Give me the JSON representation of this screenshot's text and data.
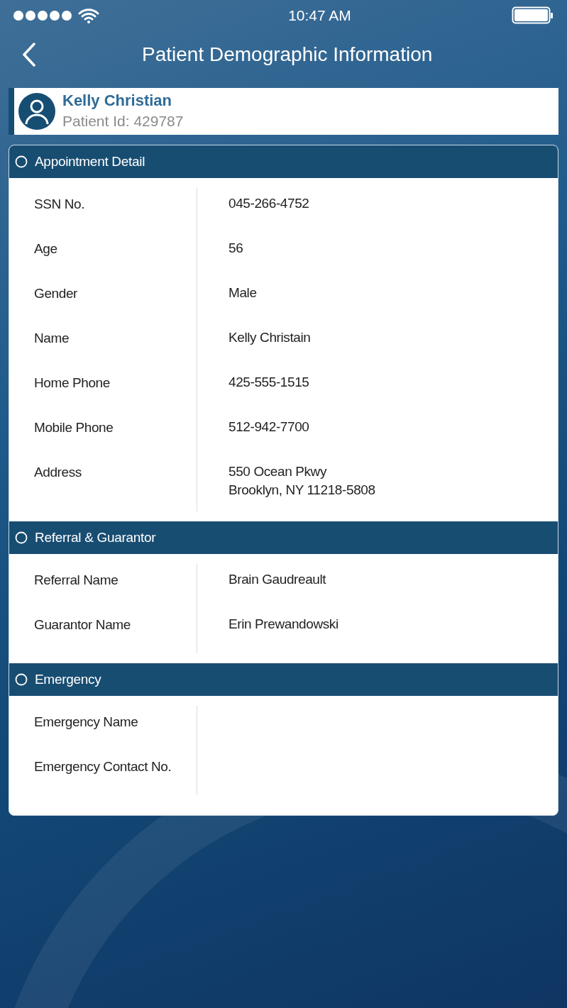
{
  "status_bar": {
    "time": "10:47 AM"
  },
  "nav": {
    "title": "Patient Demographic Information"
  },
  "patient": {
    "name": "Kelly Christian",
    "id_label": "Patient Id: 429787"
  },
  "sections": [
    {
      "title": "Appointment Detail",
      "selected": false,
      "rows": [
        {
          "label": "SSN No.",
          "value": "045-266-4752"
        },
        {
          "label": "Age",
          "value": "56"
        },
        {
          "label": "Gender",
          "value": "Male"
        },
        {
          "label": "Name",
          "value": "Kelly Christain"
        },
        {
          "label": "Home Phone",
          "value": "425-555-1515"
        },
        {
          "label": "Mobile Phone",
          "value": "512-942-7700"
        },
        {
          "label": "Address",
          "value": "550 Ocean Pkwy\nBrooklyn, NY 11218-5808"
        }
      ]
    },
    {
      "title": "Referral & Guarantor",
      "selected": false,
      "rows": [
        {
          "label": "Referral Name",
          "value": "Brain Gaudreault"
        },
        {
          "label": "Guarantor Name",
          "value": "Erin Prewandowski"
        }
      ]
    },
    {
      "title": "Emergency",
      "selected": false,
      "rows": [
        {
          "label": "Emergency Name"
        },
        {
          "label": "Emergency Contact No."
        }
      ]
    }
  ]
}
